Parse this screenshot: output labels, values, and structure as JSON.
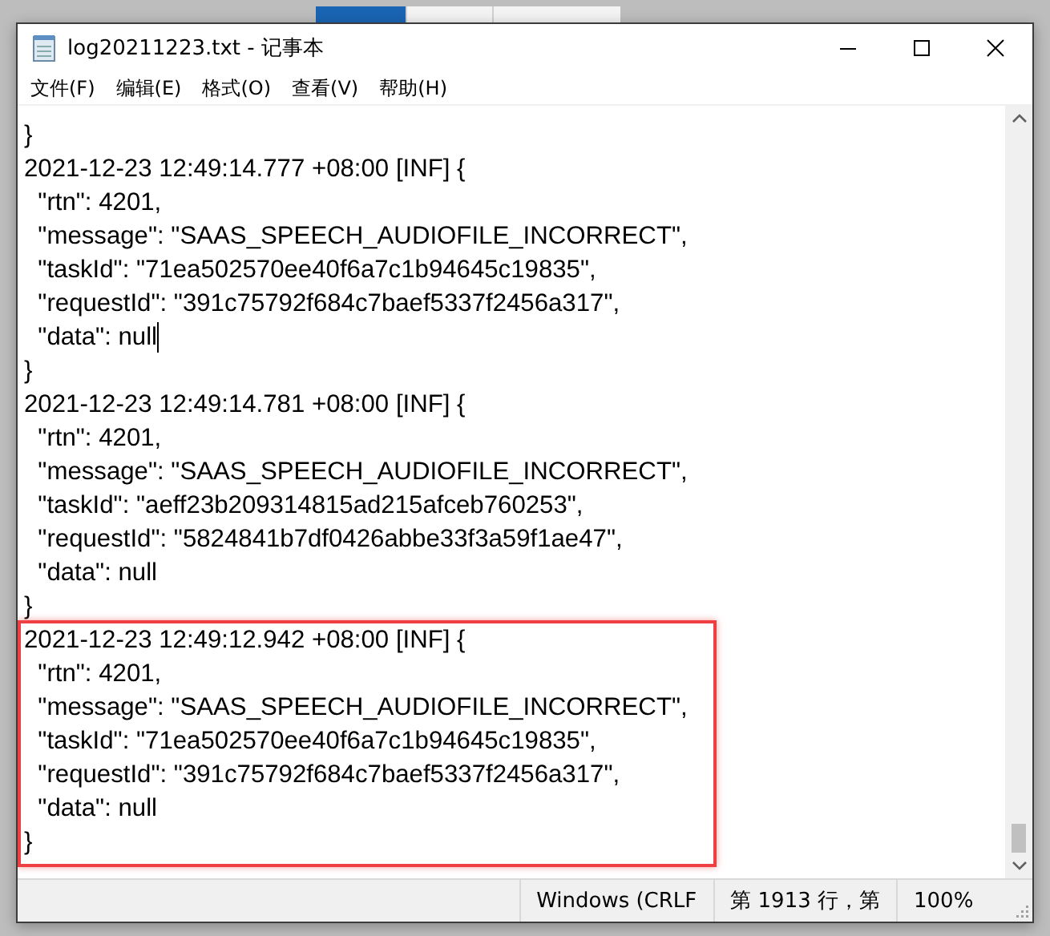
{
  "window": {
    "title": "log20211223.txt - 记事本"
  },
  "menu": [
    {
      "label": "文件(F)"
    },
    {
      "label": "编辑(E)"
    },
    {
      "label": "格式(O)"
    },
    {
      "label": "查看(V)"
    },
    {
      "label": "帮助(H)"
    }
  ],
  "text_blocks": [
    {
      "highlighted": false,
      "lines": [
        {
          "text": "}",
          "cursor": false
        },
        {
          "text": "2021-12-23 12:49:14.777 +08:00 [INF] {",
          "cursor": false
        },
        {
          "text": "  \"rtn\": 4201,",
          "cursor": false
        },
        {
          "text": "  \"message\": \"SAAS_SPEECH_AUDIOFILE_INCORRECT\",",
          "cursor": false
        },
        {
          "text": "  \"taskId\": \"71ea502570ee40f6a7c1b94645c19835\",",
          "cursor": false
        },
        {
          "text": "  \"requestId\": \"391c75792f684c7baef5337f2456a317\",",
          "cursor": false
        },
        {
          "text": "  \"data\": null",
          "cursor": true
        },
        {
          "text": "}",
          "cursor": false
        },
        {
          "text": "2021-12-23 12:49:14.781 +08:00 [INF] {",
          "cursor": false
        },
        {
          "text": "  \"rtn\": 4201,",
          "cursor": false
        },
        {
          "text": "  \"message\": \"SAAS_SPEECH_AUDIOFILE_INCORRECT\",",
          "cursor": false
        },
        {
          "text": "  \"taskId\": \"aeff23b209314815ad215afceb760253\",",
          "cursor": false
        },
        {
          "text": "  \"requestId\": \"5824841b7df0426abbe33f3a59f1ae47\",",
          "cursor": false
        },
        {
          "text": "  \"data\": null",
          "cursor": false
        },
        {
          "text": "}",
          "cursor": false
        }
      ]
    },
    {
      "highlighted": true,
      "lines": [
        {
          "text": "2021-12-23 12:49:12.942 +08:00 [INF] {",
          "cursor": false
        },
        {
          "text": "  \"rtn\": 4201,",
          "cursor": false
        },
        {
          "text": "  \"message\": \"SAAS_SPEECH_AUDIOFILE_INCORRECT\",",
          "cursor": false
        },
        {
          "text": "  \"taskId\": \"71ea502570ee40f6a7c1b94645c19835\",",
          "cursor": false
        },
        {
          "text": "  \"requestId\": \"391c75792f684c7baef5337f2456a317\",",
          "cursor": false
        },
        {
          "text": "  \"data\": null",
          "cursor": false
        },
        {
          "text": "}",
          "cursor": false
        }
      ]
    }
  ],
  "status_bar": [
    {
      "text": "Windows (CRLF"
    },
    {
      "text": "第 1913 行，第"
    },
    {
      "text": "100%"
    }
  ]
}
